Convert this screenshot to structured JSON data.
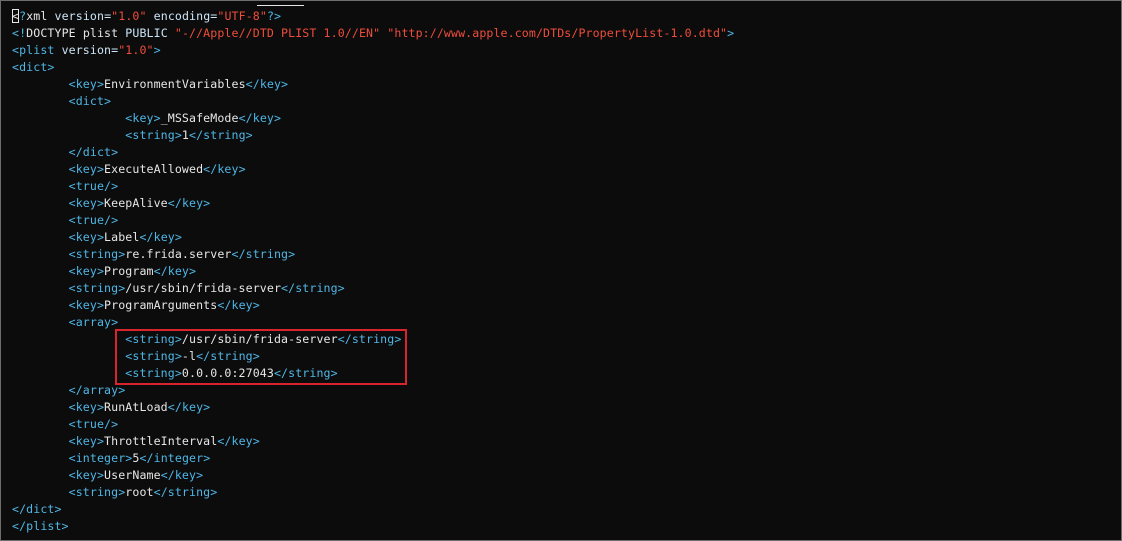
{
  "editor": {
    "lines": [
      {
        "indent": "",
        "segments": [
          [
            "cursor",
            "<"
          ],
          [
            "t",
            "?"
          ],
          [
            "x",
            "xml "
          ],
          [
            "a",
            "version="
          ],
          [
            "s",
            "\"1.0\""
          ],
          [
            "x",
            " "
          ],
          [
            "a",
            "encoding="
          ],
          [
            "s",
            "\"UTF-8\""
          ],
          [
            "t",
            "?>"
          ]
        ]
      },
      {
        "indent": "",
        "segments": [
          [
            "t",
            "<!"
          ],
          [
            "x",
            "DOCTYPE "
          ],
          [
            "x",
            "plist "
          ],
          [
            "a",
            "PUBLIC "
          ],
          [
            "s",
            "\"-//Apple//DTD PLIST 1.0//EN\""
          ],
          [
            "x",
            " "
          ],
          [
            "s",
            "\"http://www.apple.com/DTDs/PropertyList-1.0.dtd\""
          ],
          [
            "t",
            ">"
          ]
        ]
      },
      {
        "indent": "",
        "segments": [
          [
            "t",
            "<plist "
          ],
          [
            "a",
            "version="
          ],
          [
            "s",
            "\"1.0\""
          ],
          [
            "t",
            ">"
          ]
        ]
      },
      {
        "indent": "",
        "segments": [
          [
            "t",
            "<dict>"
          ]
        ]
      },
      {
        "indent": "        ",
        "segments": [
          [
            "t",
            "<key>"
          ],
          [
            "x",
            "EnvironmentVariables"
          ],
          [
            "t",
            "</key>"
          ]
        ]
      },
      {
        "indent": "        ",
        "segments": [
          [
            "t",
            "<dict>"
          ]
        ]
      },
      {
        "indent": "                ",
        "segments": [
          [
            "t",
            "<key>"
          ],
          [
            "x",
            "_MSSafeMode"
          ],
          [
            "t",
            "</key>"
          ]
        ]
      },
      {
        "indent": "                ",
        "segments": [
          [
            "t",
            "<string>"
          ],
          [
            "x",
            "1"
          ],
          [
            "t",
            "</string>"
          ]
        ]
      },
      {
        "indent": "        ",
        "segments": [
          [
            "t",
            "</dict>"
          ]
        ]
      },
      {
        "indent": "        ",
        "segments": [
          [
            "t",
            "<key>"
          ],
          [
            "x",
            "ExecuteAllowed"
          ],
          [
            "t",
            "</key>"
          ]
        ]
      },
      {
        "indent": "        ",
        "segments": [
          [
            "t",
            "<true/>"
          ]
        ]
      },
      {
        "indent": "        ",
        "segments": [
          [
            "t",
            "<key>"
          ],
          [
            "x",
            "KeepAlive"
          ],
          [
            "t",
            "</key>"
          ]
        ]
      },
      {
        "indent": "        ",
        "segments": [
          [
            "t",
            "<true/>"
          ]
        ]
      },
      {
        "indent": "        ",
        "segments": [
          [
            "t",
            "<key>"
          ],
          [
            "x",
            "Label"
          ],
          [
            "t",
            "</key>"
          ]
        ]
      },
      {
        "indent": "        ",
        "segments": [
          [
            "t",
            "<string>"
          ],
          [
            "x",
            "re.frida.server"
          ],
          [
            "t",
            "</string>"
          ]
        ]
      },
      {
        "indent": "        ",
        "segments": [
          [
            "t",
            "<key>"
          ],
          [
            "x",
            "Program"
          ],
          [
            "t",
            "</key>"
          ]
        ]
      },
      {
        "indent": "        ",
        "segments": [
          [
            "t",
            "<string>"
          ],
          [
            "x",
            "/usr/sbin/frida-server"
          ],
          [
            "t",
            "</string>"
          ]
        ]
      },
      {
        "indent": "        ",
        "segments": [
          [
            "t",
            "<key>"
          ],
          [
            "x",
            "ProgramArguments"
          ],
          [
            "t",
            "</key>"
          ]
        ]
      },
      {
        "indent": "        ",
        "segments": [
          [
            "t",
            "<array>"
          ]
        ]
      },
      {
        "indent": "                ",
        "segments": [
          [
            "t",
            "<string>"
          ],
          [
            "x",
            "/usr/sbin/frida-server"
          ],
          [
            "t",
            "</string>"
          ]
        ]
      },
      {
        "indent": "                ",
        "segments": [
          [
            "t",
            "<string>"
          ],
          [
            "x",
            "-l"
          ],
          [
            "t",
            "</string>"
          ]
        ]
      },
      {
        "indent": "                ",
        "segments": [
          [
            "t",
            "<string>"
          ],
          [
            "x",
            "0.0.0.0:27043"
          ],
          [
            "t",
            "</string>"
          ]
        ]
      },
      {
        "indent": "        ",
        "segments": [
          [
            "t",
            "</array>"
          ]
        ]
      },
      {
        "indent": "        ",
        "segments": [
          [
            "t",
            "<key>"
          ],
          [
            "x",
            "RunAtLoad"
          ],
          [
            "t",
            "</key>"
          ]
        ]
      },
      {
        "indent": "        ",
        "segments": [
          [
            "t",
            "<true/>"
          ]
        ]
      },
      {
        "indent": "        ",
        "segments": [
          [
            "t",
            "<key>"
          ],
          [
            "x",
            "ThrottleInterval"
          ],
          [
            "t",
            "</key>"
          ]
        ]
      },
      {
        "indent": "        ",
        "segments": [
          [
            "t",
            "<integer>"
          ],
          [
            "x",
            "5"
          ],
          [
            "t",
            "</integer>"
          ]
        ]
      },
      {
        "indent": "        ",
        "segments": [
          [
            "t",
            "<key>"
          ],
          [
            "x",
            "UserName"
          ],
          [
            "t",
            "</key>"
          ]
        ]
      },
      {
        "indent": "        ",
        "segments": [
          [
            "t",
            "<string>"
          ],
          [
            "x",
            "root"
          ],
          [
            "t",
            "</string>"
          ]
        ]
      },
      {
        "indent": "",
        "segments": [
          [
            "t",
            "</dict>"
          ]
        ]
      },
      {
        "indent": "",
        "segments": [
          [
            "t",
            "</plist>"
          ]
        ]
      }
    ]
  },
  "colors": {
    "background": "#0c0c0c",
    "tag": "#4fb6e6",
    "attribute": "#cde5f7",
    "string_value": "#ef4d3b",
    "text": "#e6e6e6",
    "highlight_box": "#d8252d"
  }
}
